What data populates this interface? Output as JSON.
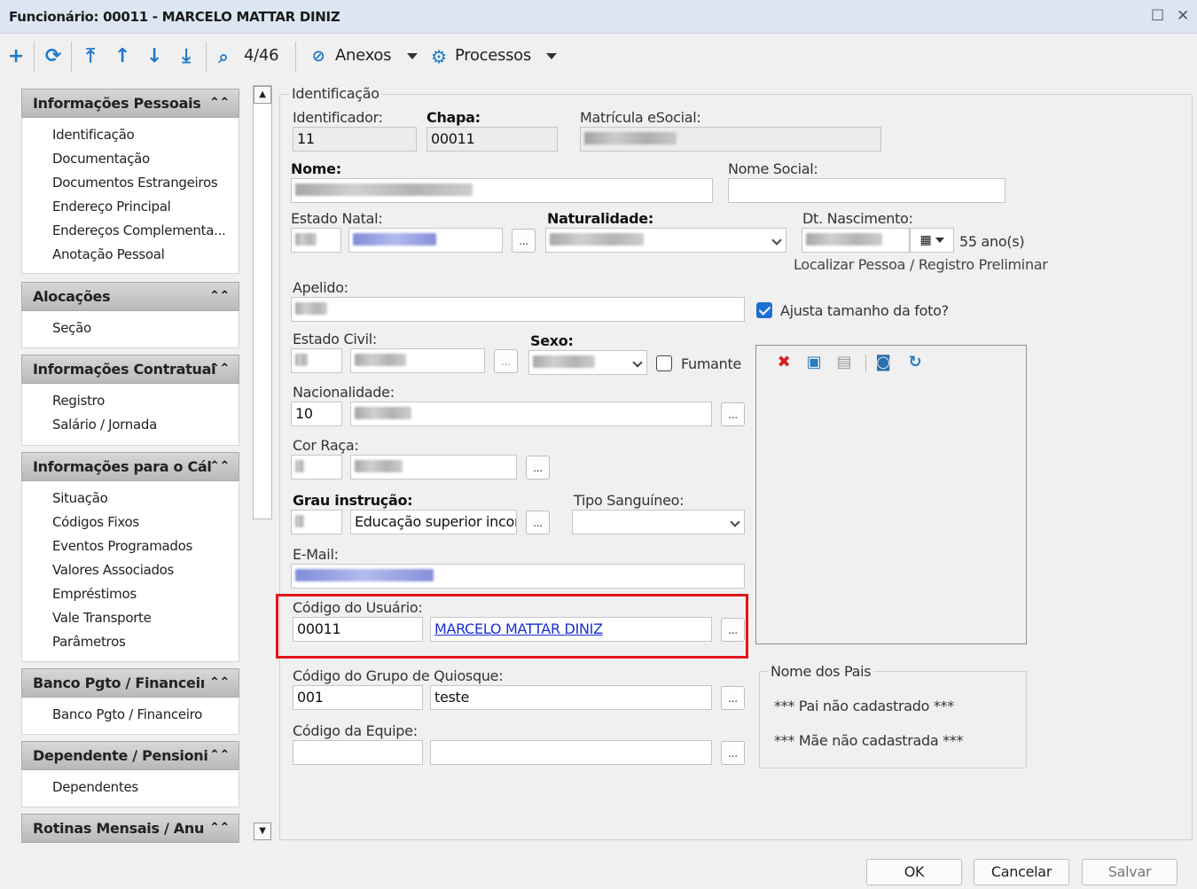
{
  "window": {
    "title": "Funcionário: 00011 - MARCELO MATTAR DINIZ",
    "maximize_icon": "maximize-icon",
    "close_icon": "close-icon"
  },
  "toolbar": {
    "record_position": "4/46",
    "attachments_label": "Anexos",
    "processes_label": "Processos",
    "icons": [
      "add-icon",
      "refresh-icon",
      "first-record-icon",
      "previous-record-icon",
      "next-record-icon",
      "last-record-icon",
      "search-icon",
      "paperclip-icon",
      "gear-icon"
    ]
  },
  "sidebar": {
    "sections": [
      {
        "title": "Informações Pessoais",
        "items": [
          "Identificação",
          "Documentação",
          "Documentos Estrangeiros",
          "Endereço Principal",
          "Endereços Complementa...",
          "Anotação Pessoal"
        ]
      },
      {
        "title": "Alocações",
        "items": [
          "Seção"
        ]
      },
      {
        "title": "Informações Contratuai",
        "items": [
          "Registro",
          "Salário / Jornada"
        ]
      },
      {
        "title": "Informações para o Cál",
        "items": [
          "Situação",
          "Códigos Fixos",
          "Eventos Programados",
          "Valores Associados",
          "Empréstimos",
          "Vale Transporte",
          "Parâmetros"
        ]
      },
      {
        "title": "Banco Pgto / Financeiı",
        "items": [
          "Banco Pgto / Financeiro"
        ]
      },
      {
        "title": "Dependente / Pensioni",
        "items": [
          "Dependentes"
        ]
      },
      {
        "title": "Rotinas Mensais / Anu",
        "items": []
      }
    ]
  },
  "form": {
    "group_title": "Identificação",
    "identificador": {
      "label": "Identificador:",
      "value": "11"
    },
    "chapa": {
      "label": "Chapa:",
      "value": "00011"
    },
    "matricula": {
      "label": "Matrícula eSocial:"
    },
    "nome": {
      "label": "Nome:"
    },
    "nome_social": {
      "label": "Nome Social:"
    },
    "estado_natal": {
      "label": "Estado Natal:"
    },
    "naturalidade": {
      "label": "Naturalidade:"
    },
    "dt_nascimento": {
      "label": "Dt. Nascimento:",
      "age": "55 ano(s)"
    },
    "localizar_link": "Localizar Pessoa / Registro Preliminar",
    "apelido": {
      "label": "Apelido:"
    },
    "ajusta_foto": {
      "label": "Ajusta tamanho da foto?",
      "checked": true
    },
    "estado_civil": {
      "label": "Estado Civil:"
    },
    "sexo": {
      "label": "Sexo:"
    },
    "fumante": {
      "label": "Fumante",
      "checked": false
    },
    "nacionalidade": {
      "label": "Nacionalidade:",
      "value": "10"
    },
    "cor_raca": {
      "label": "Cor Raça:"
    },
    "grau_instrucao": {
      "label": "Grau instrução:",
      "description": "Educação superior incom"
    },
    "tipo_sanguineo": {
      "label": "Tipo Sanguíneo:"
    },
    "email": {
      "label": "E-Mail:"
    },
    "codigo_usuario": {
      "label": "Código do Usuário:",
      "value": "00011",
      "name": "MARCELO MATTAR DINIZ"
    },
    "codigo_grupo_quiosque": {
      "label": "Código do Grupo de Quiosque:",
      "value": "001",
      "description": "teste"
    },
    "codigo_equipe": {
      "label": "Código da Equipe:"
    },
    "ellipsis": "..."
  },
  "photo_toolbar": {
    "icons": [
      "delete-photo-icon",
      "load-image-icon",
      "save-image-icon",
      "camera-icon",
      "rotate-icon"
    ]
  },
  "parents": {
    "title": "Nome dos Pais",
    "father": "*** Pai não cadastrado ***",
    "mother": "*** Mãe não cadastrada ***"
  },
  "footer": {
    "ok": "OK",
    "cancel": "Cancelar",
    "save": "Salvar"
  },
  "colors": {
    "highlight_border": "#e3141b",
    "link": "#1a2fd0",
    "toolbar_icon": "#1f78c8"
  }
}
